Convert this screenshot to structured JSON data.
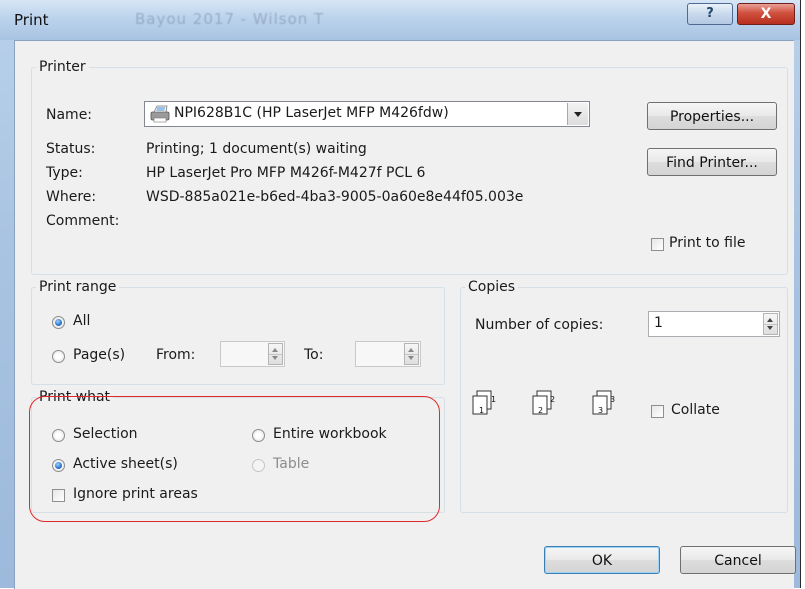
{
  "window": {
    "title": "Print",
    "ghost_title": "Bayou 2017 - Wilson T",
    "help_glyph": "?",
    "close_glyph": "X"
  },
  "printer": {
    "legend": "Printer",
    "name_label": "Name:",
    "name_value": "NPI628B1C (HP LaserJet MFP M426fdw)",
    "printer_icon": "printer-icon",
    "status_label": "Status:",
    "status_value": "Printing; 1 document(s) waiting",
    "type_label": "Type:",
    "type_value": "HP LaserJet Pro MFP M426f-M427f PCL 6",
    "where_label": "Where:",
    "where_value": "WSD-885a021e-b6ed-4ba3-9005-0a60e8e44f05.003e",
    "comment_label": "Comment:",
    "properties_button": "Properties...",
    "find_printer_button": "Find Printer...",
    "print_to_file_label": "Print to file",
    "print_to_file_checked": false
  },
  "print_range": {
    "legend": "Print range",
    "all_label": "All",
    "all_selected": true,
    "pages_label": "Page(s)",
    "from_label": "From:",
    "to_label": "To:",
    "from_value": "",
    "to_value": ""
  },
  "copies": {
    "legend": "Copies",
    "number_label": "Number of copies:",
    "number_value": "1",
    "collate_label": "Collate",
    "collate_checked": false,
    "page_icons": [
      "1",
      "2",
      "3"
    ]
  },
  "print_what": {
    "legend": "Print what",
    "selection_label": "Selection",
    "active_sheets_label": "Active sheet(s)",
    "active_sheets_selected": true,
    "ignore_label": "Ignore print areas",
    "ignore_checked": false,
    "entire_workbook_label": "Entire workbook",
    "table_label": "Table",
    "table_enabled": false,
    "highlight_color": "#e02a2a"
  },
  "footer": {
    "ok_button": "OK",
    "cancel_button": "Cancel"
  },
  "colors": {
    "frame": "#a9c4e2",
    "client_bg": "#f0f0f0",
    "close_button": "#c8402f",
    "radio_dot": "#2a72c9"
  }
}
